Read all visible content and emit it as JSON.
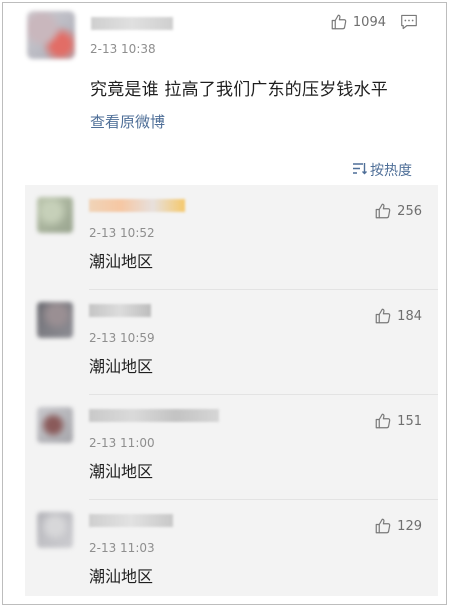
{
  "post": {
    "time": "2-13 10:38",
    "likes": "1094",
    "text": "究竟是谁 拉高了我们广东的压岁钱水平",
    "view_original": "查看原微博",
    "sort_label": "按热度"
  },
  "replies": [
    {
      "time": "2-13 10:52",
      "text": "潮汕地区",
      "likes": "256"
    },
    {
      "time": "2-13 10:59",
      "text": "潮汕地区",
      "likes": "184"
    },
    {
      "time": "2-13 11:00",
      "text": "潮汕地区",
      "likes": "151"
    },
    {
      "time": "2-13 11:03",
      "text": "潮汕地区",
      "likes": "129"
    }
  ],
  "icons": {
    "like": "thumbs-up-icon",
    "comment": "comment-icon",
    "sort": "sort-icon"
  }
}
